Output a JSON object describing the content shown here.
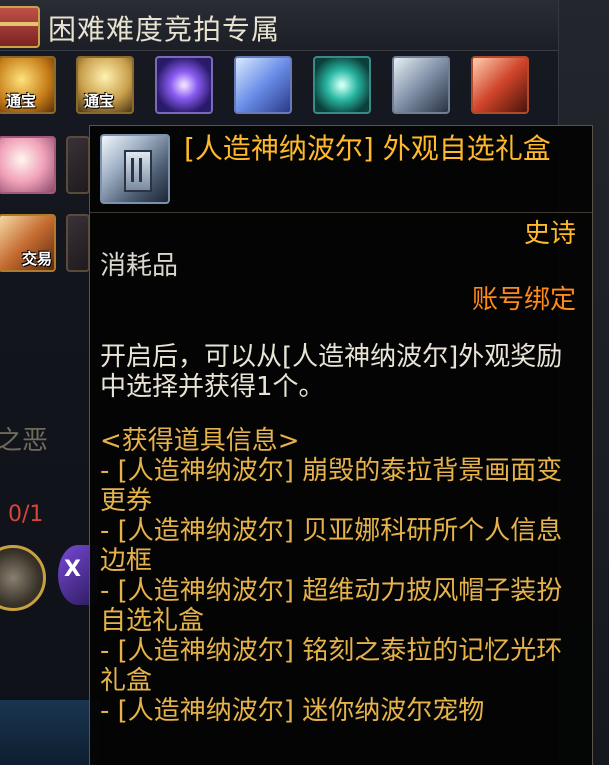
{
  "header": {
    "title": "困难难度竞拍专属"
  },
  "item_slots": {
    "row1": [
      {
        "icon": "gold-treasure-icon",
        "tag": "通宝"
      },
      {
        "icon": "gold-chest-icon",
        "tag": "通宝"
      },
      {
        "icon": "purple-orb-icon",
        "tag": ""
      },
      {
        "icon": "crystal-icon",
        "tag": ""
      },
      {
        "icon": "teal-orb-icon",
        "tag": ""
      },
      {
        "icon": "book-icon",
        "tag": ""
      },
      {
        "icon": "red-box-icon",
        "tag": ""
      }
    ],
    "row2_left_tag": "",
    "row3_left_tag": "交易"
  },
  "background": {
    "side_text": "之恶",
    "progress": "0/1",
    "x_label": "X"
  },
  "tooltip": {
    "title": "[人造神纳波尔] 外观自选礼盒",
    "rarity": "史诗",
    "category": "消耗品",
    "binding": "账号绑定",
    "description": "开启后，可以从[人造神纳波尔]外观奖励中选择并获得1个。",
    "list_header": "<获得道具信息>",
    "items": [
      "- [人造神纳波尔] 崩毁的泰拉背景画面变更券",
      "- [人造神纳波尔] 贝亚娜科研所个人信息边框",
      "- [人造神纳波尔] 超维动力披风帽子装扮自选礼盒",
      "- [人造神纳波尔] 铭刻之泰拉的记忆光环礼盒",
      "- [人造神纳波尔] 迷你纳波尔宠物"
    ]
  }
}
